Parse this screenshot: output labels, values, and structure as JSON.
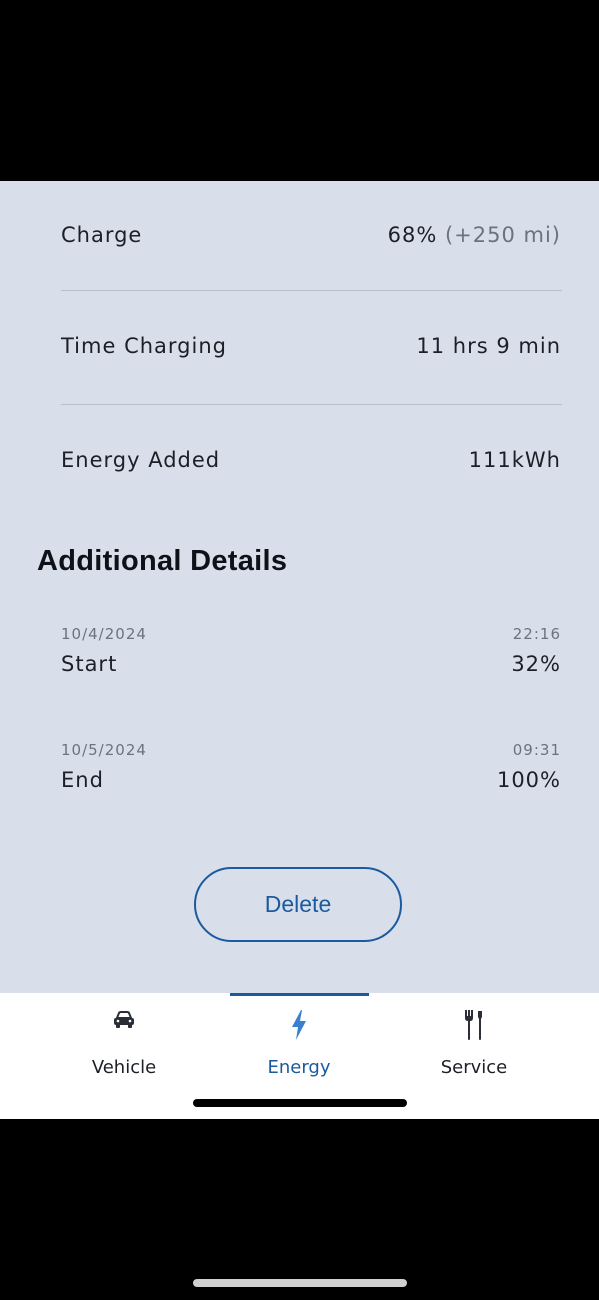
{
  "stats": {
    "charge": {
      "label": "Charge",
      "value": "68%",
      "sub": "(+250 mi)"
    },
    "time_charging": {
      "label": "Time Charging",
      "value": "11 hrs 9 min"
    },
    "energy_added": {
      "label": "Energy Added",
      "value": "111kWh"
    }
  },
  "additional": {
    "title": "Additional Details",
    "items": [
      {
        "date": "10/4/2024",
        "time": "22:16",
        "name": "Start",
        "percent": "32%"
      },
      {
        "date": "10/5/2024",
        "time": "09:31",
        "name": "End",
        "percent": "100%"
      }
    ]
  },
  "delete_label": "Delete",
  "tabs": [
    {
      "label": "Vehicle",
      "icon": "car-icon",
      "active": false
    },
    {
      "label": "Energy",
      "icon": "lightning-bolt-icon",
      "active": true
    },
    {
      "label": "Service",
      "icon": "tools-icon",
      "active": false
    }
  ],
  "colors": {
    "accent": "#1b5a9e",
    "panel_bg": "#d9dfea",
    "muted_text": "#6c7280"
  }
}
